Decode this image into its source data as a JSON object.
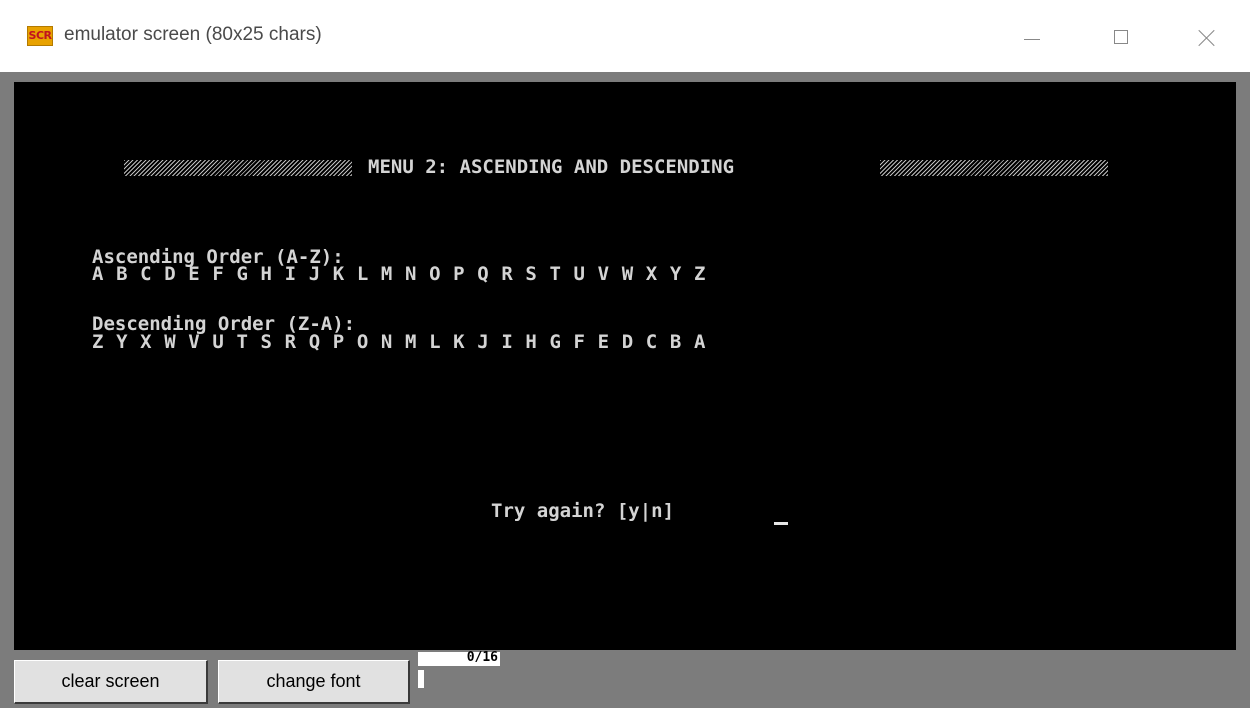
{
  "window": {
    "title": "emulator screen (80x25 chars)",
    "icon_label": "SCR",
    "icon_color": "#e8a200"
  },
  "screen": {
    "menu_title": "MENU 2: ASCENDING AND DESCENDING",
    "ascending_label": "Ascending Order (A-Z):",
    "ascending_letters": "A B C D E F G H I J K L M N O P Q R S T U V W X Y Z",
    "descending_label": "Descending Order (Z-A):",
    "descending_letters": "Z Y X W V U T S R Q P O N M L K J I H G F E D C B A",
    "prompt": "Try again? [y|n]"
  },
  "toolbar": {
    "clear_label": "clear screen",
    "font_label": "change font",
    "counter": "0/16"
  },
  "icons": {
    "minimize": "minimize-icon",
    "maximize": "maximize-icon",
    "close": "close-icon"
  }
}
